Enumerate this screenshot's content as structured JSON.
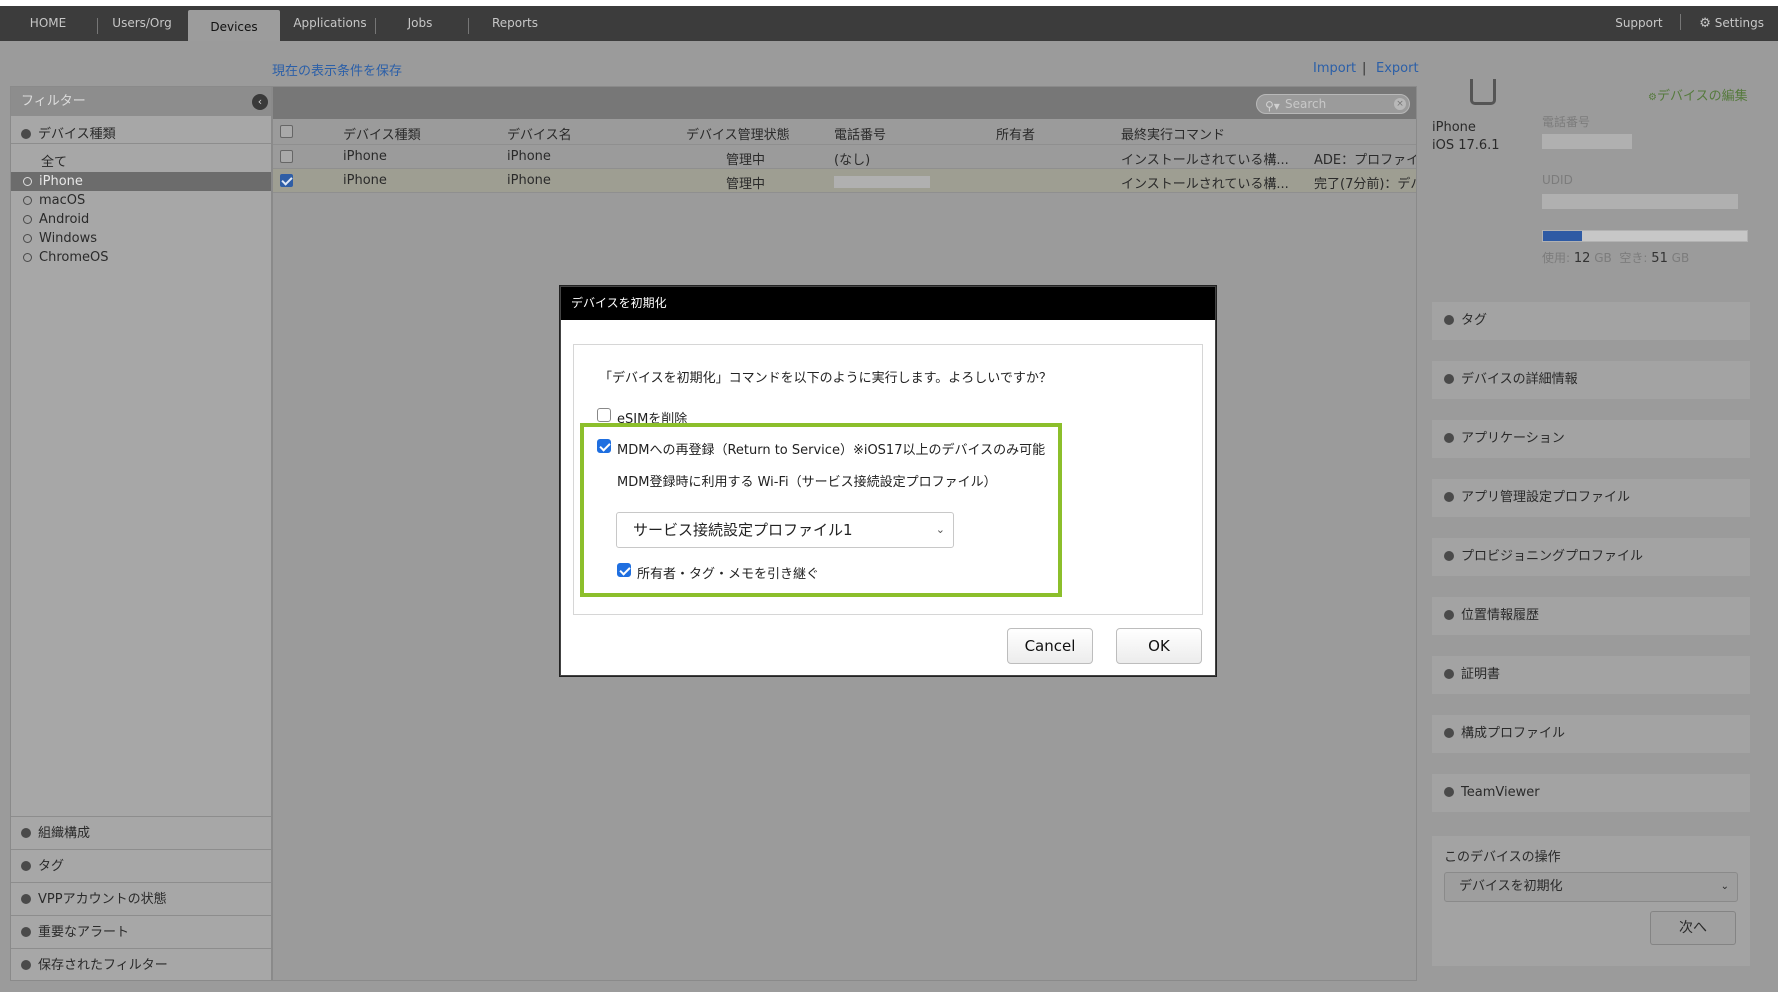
{
  "nav": {
    "tabs": [
      {
        "label": "HOME"
      },
      {
        "label": "Users/Org"
      },
      {
        "label": "Devices"
      },
      {
        "label": "Applications"
      },
      {
        "label": "Jobs"
      },
      {
        "label": "Reports"
      }
    ],
    "support": "Support",
    "settings": "Settings",
    "active_tab": "Devices"
  },
  "toolbar": {
    "save_view": "現在の表示条件を保存",
    "import": "Import",
    "separator": "|",
    "export": "Export"
  },
  "filter": {
    "title": "フィルター",
    "device_type_header": "デバイス種類",
    "types": [
      "全て",
      "iPhone",
      "macOS",
      "Android",
      "Windows",
      "ChromeOS"
    ],
    "selected_type": "iPhone",
    "bottom_sections": [
      "組織構成",
      "タグ",
      "VPPアカウントの状態",
      "重要なアラート",
      "保存されたフィルター"
    ]
  },
  "search": {
    "placeholder": "Search"
  },
  "table": {
    "headers": [
      "デバイス種類",
      "デバイス名",
      "デバイス管理状態",
      "電話番号",
      "所有者",
      "最終実行コマンド"
    ],
    "rows": [
      {
        "type": "iPhone",
        "name": "iPhone",
        "status": "管理中",
        "phone": "(なし)",
        "owner": "",
        "last_command": "インストールされている構...",
        "last_command_status": "ADE：プロファイ",
        "checked": false
      },
      {
        "type": "iPhone",
        "name": "iPhone",
        "status": "管理中",
        "phone": "",
        "owner": "",
        "last_command": "インストールされている構...",
        "last_command_status": "完了(7分前)：デバ",
        "checked": true
      }
    ]
  },
  "device_panel": {
    "edit_link": "デバイスの編集",
    "model": "iPhone",
    "os": "iOS 17.6.1",
    "phone_label": "電話番号",
    "udid_label": "UDID",
    "storage": {
      "used_label": "使用:",
      "used_value": "12",
      "free_label": "空き:",
      "free_value": "51",
      "unit": "GB",
      "used_fraction": 0.19
    },
    "sections": [
      "タグ",
      "デバイスの詳細情報",
      "アプリケーション",
      "アプリ管理設定プロファイル",
      "プロビジョニングプロファイル",
      "位置情報履歴",
      "証明書",
      "構成プロファイル",
      "TeamViewer"
    ],
    "operations_title": "このデバイスの操作",
    "operation_selected": "デバイスを初期化",
    "next_button": "次へ"
  },
  "modal": {
    "title": "デバイスを初期化",
    "message": "「デバイスを初期化」コマンドを以下のように実行します。よろしいですか？",
    "esim_label": "eSIMを削除",
    "esim_checked": false,
    "rts_label": "MDMへの再登録（Return to Service）※iOS17以上のデバイスのみ可能",
    "rts_checked": true,
    "wifi_label": "MDM登録時に利用する Wi-Fi（サービス接続設定プロファイル）",
    "wifi_profile": "サービス接続設定プロファイル1",
    "keep_label": "所有者・タグ・メモを引き継ぐ",
    "keep_checked": true,
    "cancel_button": "Cancel",
    "ok_button": "OK",
    "highlight_color": "#8cbf2b"
  },
  "colors": {
    "nav_bg": "#3c3c3c",
    "link": "#2b5fa8",
    "checkbox_blue": "#1f6fe0",
    "modal_header": "#000000"
  }
}
